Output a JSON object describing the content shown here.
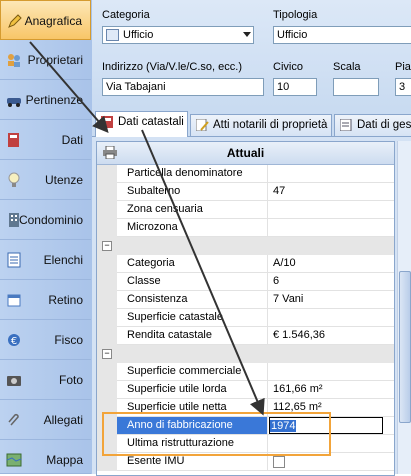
{
  "sidebar": {
    "items": [
      {
        "label": "Anagrafica",
        "icon": "pencil-icon",
        "active": true
      },
      {
        "label": "Proprietari",
        "icon": "people-icon"
      },
      {
        "label": "Pertinenze",
        "icon": "car-icon"
      },
      {
        "label": "Dati",
        "icon": "book-icon"
      },
      {
        "label": "Utenze",
        "icon": "lightbulb-icon"
      },
      {
        "label": "Condominio",
        "icon": "building-icon"
      },
      {
        "label": "Elenchi",
        "icon": "list-icon"
      },
      {
        "label": "Retino",
        "icon": "calendar-icon"
      },
      {
        "label": "Fisco",
        "icon": "tax-icon"
      },
      {
        "label": "Foto",
        "icon": "camera-icon"
      },
      {
        "label": "Allegati",
        "icon": "paperclip-icon"
      },
      {
        "label": "Mappa",
        "icon": "map-icon"
      }
    ]
  },
  "form": {
    "categoria_label": "Categoria",
    "categoria_value": "Ufficio",
    "tipologia_label": "Tipologia",
    "tipologia_value": "Ufficio",
    "indirizzo_label": "Indirizzo (Via/V.le/C.so, ecc.)",
    "indirizzo_value": "Via Tabajani",
    "civico_label": "Civico",
    "civico_value": "10",
    "scala_label": "Scala",
    "scala_value": "",
    "piano_label": "Pia",
    "piano_value": "3"
  },
  "tabs": [
    {
      "label": "Dati catastali",
      "active": true
    },
    {
      "label": "Atti notarili di proprietà"
    },
    {
      "label": "Dati di ges"
    }
  ],
  "grid": {
    "title": "Attuali",
    "rows": [
      {
        "name": "Particella denominatore",
        "value": ""
      },
      {
        "name": "Subalterno",
        "value": "47"
      },
      {
        "name": "Zona censuaria",
        "value": ""
      },
      {
        "name": "Microzona",
        "value": ""
      },
      {
        "sep": true
      },
      {
        "name": "Categoria",
        "value": "A/10"
      },
      {
        "name": "Classe",
        "value": "6"
      },
      {
        "name": "Consistenza",
        "value": "7 Vani"
      },
      {
        "name": "Superficie catastale",
        "value": ""
      },
      {
        "name": "Rendita catastale",
        "value": "€ 1.546,36"
      },
      {
        "sep": true
      },
      {
        "name": "Superficie commerciale",
        "value": ""
      },
      {
        "name": "Superficie utile lorda",
        "value": "161,66 m²"
      },
      {
        "name": "Superficie utile netta",
        "value": "112,65 m²"
      },
      {
        "name": "Anno di fabbricazione",
        "value": "1974",
        "selected": true
      },
      {
        "name": "Ultima ristrutturazione",
        "value": ""
      },
      {
        "name": "Esente IMU",
        "value": "",
        "checkbox": true
      }
    ]
  },
  "colors": {
    "accent": "#f2a43a",
    "selection": "#3a78d8",
    "sidebar": "#bcd2f0"
  }
}
